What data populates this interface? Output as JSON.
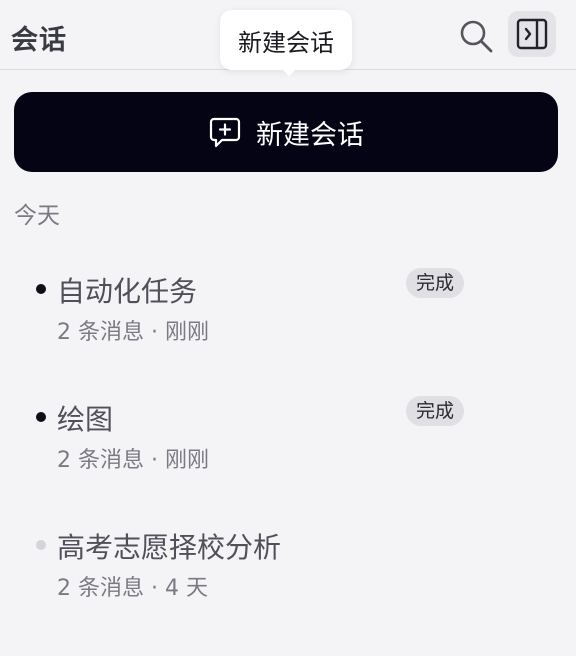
{
  "header": {
    "title": "会话",
    "search_icon": "search-icon",
    "panel_icon": "sidebar-panel-icon"
  },
  "tooltip": {
    "text": "新建会话"
  },
  "new_chat_button": {
    "label": "新建会话",
    "icon": "chat-plus-icon"
  },
  "section": {
    "label": "今天"
  },
  "conversations": [
    {
      "title": "自动化任务",
      "meta": "2 条消息 · 刚刚",
      "status": "完成",
      "dot_color": "#0e0e18"
    },
    {
      "title": "绘图",
      "meta": "2 条消息 · 刚刚",
      "status": "完成",
      "dot_color": "#0e0e18"
    },
    {
      "title": "高考志愿择校分析",
      "meta": "2 条消息 · 4 天",
      "status": "",
      "dot_color": "#d4d4da"
    }
  ],
  "colors": {
    "background": "#f4f4f6",
    "primary_button": "#050414",
    "badge_bg": "#e0e0e4"
  }
}
